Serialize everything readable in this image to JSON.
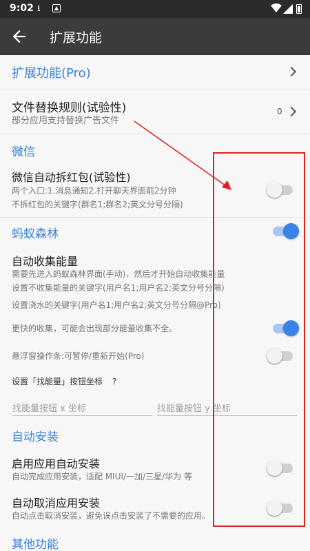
{
  "status_bar": {
    "time": "9:02"
  },
  "app_bar": {
    "title": "扩展功能"
  },
  "pro_row": {
    "label": "扩展功能(Pro)"
  },
  "file_rule": {
    "title": "文件替换规则(试验性)",
    "subtitle": "部分应用支持替换广告文件",
    "count": "0"
  },
  "wechat": {
    "section": "微信",
    "red_packet_title": "微信自动拆红包(试验性)",
    "red_packet_sub1": "两个入口:1.消息通知2.打开聊天界面前2分钟",
    "red_packet_sub2": "不拆红包的关键字(群名1;群名2;英文分号分隔)",
    "red_packet_enabled": false
  },
  "ant_forest": {
    "section": "蚂蚁森林",
    "section_enabled": true,
    "collect_title": "自动收集能量",
    "collect_sub1": "需要先进入蚂蚁森林界面(手动)，然后才开始自动收集能量",
    "collect_sub2": "设置不收集能量的关键字(用户名1;用户名2;英文分号分隔)",
    "water_keywords": "设置浇水的关键字(用户名1;用户名2;英文分号分隔@Pro)",
    "faster_collect": "更快的收集，可能会出现部分能量收集不全。",
    "faster_enabled": true,
    "floating_window": "悬浮窗操作条:可暂停/重新开始(Pro)",
    "floating_enabled": false,
    "coord_label": "设置「找能量」按钮坐标",
    "help_mark": "?",
    "x_placeholder": "找能量按钮 x 坐标",
    "y_placeholder": "找能量按钮 y 坐标"
  },
  "auto_install": {
    "section": "自动安装",
    "enable_title": "启用应用自动安装",
    "enable_sub": "自动完成应用安装，适配 MIUI/一加/三星/华为 等",
    "enable_on": false,
    "cancel_title": "自动取消应用安装",
    "cancel_sub": "自动点击取消安装，避免误点击安装了不需要的应用。",
    "cancel_on": false
  },
  "other": {
    "section": "其他功能"
  },
  "annotation_color": "#e02020",
  "accent_color": "#3b82d6"
}
